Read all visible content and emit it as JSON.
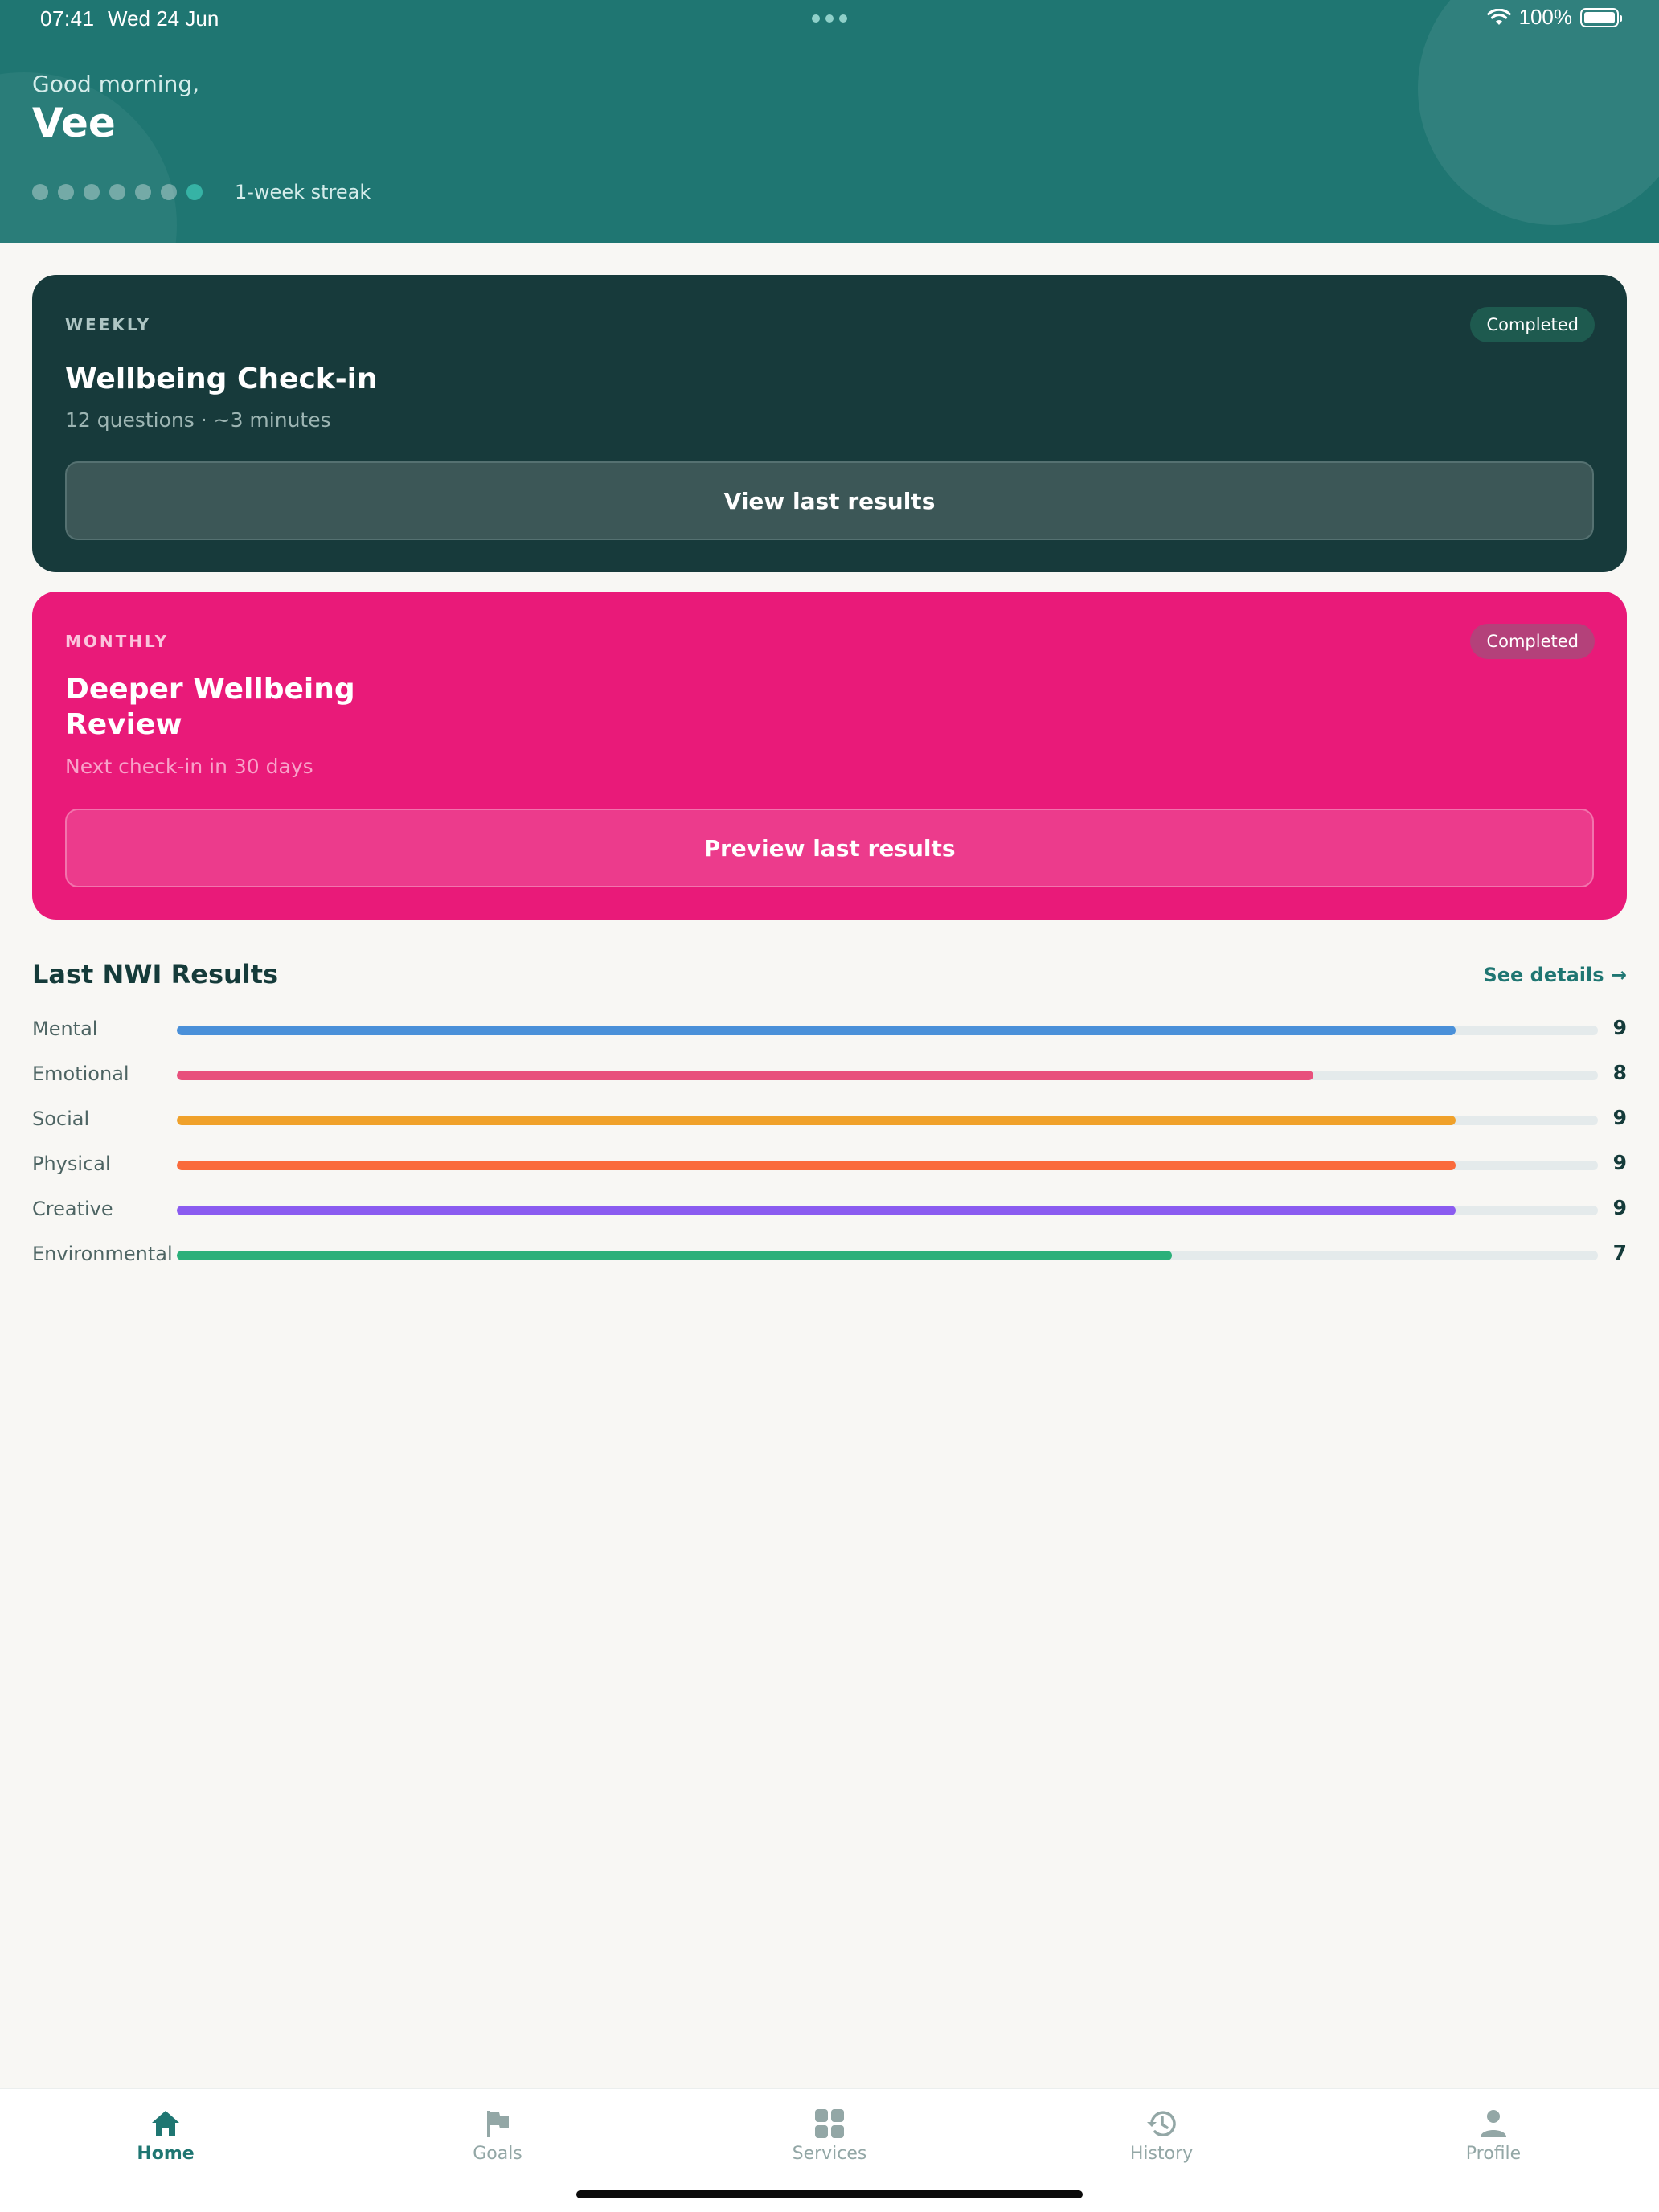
{
  "status_bar": {
    "time": "07:41",
    "date": "Wed 24 Jun",
    "battery": "100%",
    "icons": [
      "wifi-icon",
      "battery-icon"
    ]
  },
  "header": {
    "greeting": "Good morning,",
    "name": "Vee",
    "streak_days_total": 7,
    "streak_days_completed": 1,
    "streak_label": "1-week streak",
    "bg_color": "#1f7672"
  },
  "cards": {
    "weekly": {
      "kicker": "WEEKLY",
      "badge": "Completed",
      "title": "Wellbeing Check-in",
      "subtitle": "12 questions · ~3 minutes",
      "cta": "View last results",
      "bg_color": "#173a3b"
    },
    "monthly": {
      "kicker": "MONTHLY",
      "badge": "Completed",
      "title": "Deeper Wellbeing Review",
      "subtitle": "Next check-in in 30 days",
      "cta": "Preview last results",
      "bg_color": "#e91a79"
    }
  },
  "results": {
    "title": "Last NWI Results",
    "see_details": "See details →",
    "max": 10,
    "items": [
      {
        "label": "Mental",
        "value": "9",
        "score": 9,
        "color": "#4a90d9"
      },
      {
        "label": "Emotional",
        "value": "8",
        "score": 8,
        "color": "#e8507c"
      },
      {
        "label": "Social",
        "value": "9",
        "score": 9,
        "color": "#f0a12a"
      },
      {
        "label": "Physical",
        "value": "9",
        "score": 9,
        "color": "#fa6a3b"
      },
      {
        "label": "Creative",
        "value": "9",
        "score": 9,
        "color": "#8b5cf0"
      },
      {
        "label": "Environmental",
        "value": "7",
        "score": 7,
        "color": "#2bb07a"
      }
    ]
  },
  "tabbar": {
    "active": "home",
    "items": [
      {
        "key": "home",
        "label": "Home",
        "icon": "home-icon"
      },
      {
        "key": "goals",
        "label": "Goals",
        "icon": "flag-icon"
      },
      {
        "key": "services",
        "label": "Services",
        "icon": "grid-icon"
      },
      {
        "key": "history",
        "label": "History",
        "icon": "history-icon"
      },
      {
        "key": "profile",
        "label": "Profile",
        "icon": "person-icon"
      }
    ]
  }
}
